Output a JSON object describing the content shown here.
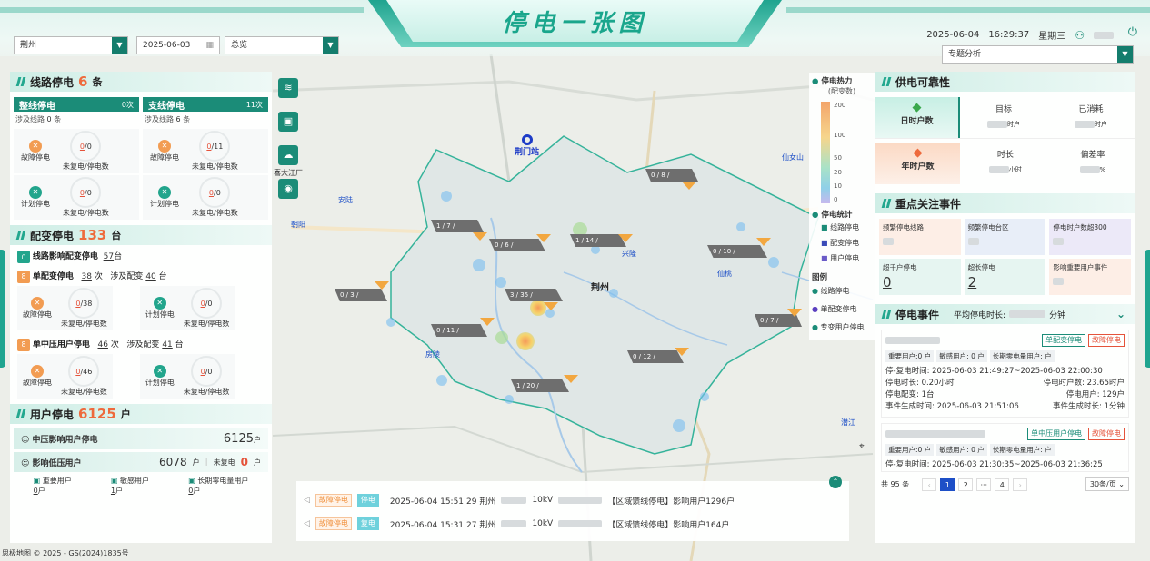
{
  "header": {
    "title": "停电一张图",
    "city": "荆州",
    "date": "2025-06-03",
    "scope": "总览",
    "now_date": "2025-06-04",
    "now_time": "16:29:37",
    "weekday": "星期三",
    "analysis": "专题分析"
  },
  "line": {
    "title": "线路停电",
    "count": "6",
    "unit": "条",
    "whole": {
      "title": "整线停电",
      "count": "0",
      "count_unit": "次",
      "involve_label": "涉及线路",
      "involve": "0",
      "involve_unit": "条",
      "fault_label": "故障停电",
      "fault_a": "0",
      "fault_b": "0",
      "plan_label": "计划停电",
      "plan_a": "0",
      "plan_b": "0"
    },
    "branch": {
      "title": "支线停电",
      "count": "11",
      "count_unit": "次",
      "involve_label": "涉及线路",
      "involve": "6",
      "involve_unit": "条",
      "fault_label": "故障停电",
      "fault_a": "0",
      "fault_b": "11",
      "plan_label": "计划停电",
      "plan_a": "0",
      "plan_b": "0"
    },
    "sub": "未复电/停电数"
  },
  "transformer": {
    "title": "配变停电",
    "count": "133",
    "unit": "台",
    "line_affect_label": "线路影响配变停电",
    "line_affect": "57",
    "line_affect_unit": "台",
    "single": {
      "title": "单配变停电",
      "count": "38",
      "count_unit": "次",
      "involve_label": "涉及配变",
      "involve": "40",
      "involve_unit": "台",
      "fault_label": "故障停电",
      "fault_a": "0",
      "fault_b": "38",
      "plan_label": "计划停电",
      "plan_a": "0",
      "plan_b": "0"
    },
    "mv": {
      "title": "单中压用户停电",
      "count": "46",
      "count_unit": "次",
      "involve_label": "涉及配变",
      "involve": "41",
      "involve_unit": "台",
      "fault_label": "故障停电",
      "fault_a": "0",
      "fault_b": "46",
      "plan_label": "计划停电",
      "plan_a": "0",
      "plan_b": "0"
    }
  },
  "user": {
    "title": "用户停电",
    "count": "6125",
    "unit": "户",
    "mv_label": "中压影响用户停电",
    "mv": "6125",
    "mv_unit": "户",
    "lv_label": "影响低压用户",
    "lv": "6078",
    "lv_unit": "户",
    "unrestored_label": "未复电",
    "unrestored": "0",
    "unrestored_unit": "户",
    "important_label": "重要用户",
    "important": "0",
    "important_unit": "户",
    "sensitive_label": "敏感用户",
    "sensitive": "1",
    "sensitive_unit": "户",
    "longzero_label": "长期零电量用户",
    "longzero": "0",
    "longzero_unit": "户"
  },
  "legend": {
    "heat_title": "停电热力",
    "heat_sub": "(配变数)",
    "ticks": [
      "200",
      "100",
      "50",
      "20",
      "10",
      "0"
    ],
    "stat_title": "停电统计",
    "stats": [
      "线路停电",
      "配变停电",
      "用户停电"
    ],
    "icon_title": "图例",
    "icons": [
      "线路停电",
      "单配变停电",
      "专变用户停电"
    ]
  },
  "map_labels": {
    "station": "荆门站",
    "city": "荆州",
    "city2": "兴隆",
    "city3": "仙桃",
    "city4": "潜江",
    "city5": "仙女山",
    "city6": "安陆",
    "city7": "朝阳",
    "city8": "房陵",
    "river": "喜大江厂",
    "attribution": "思极地图 © 2025 - GS(2024)1835号"
  },
  "map_cards": [
    "0 / 8 /",
    "1 / 7 /",
    "0 / 6 /",
    "1 / 14 /",
    "0 / 10 /",
    "0 / 3 /",
    "3 / 35 /",
    "0 / 7 /",
    "0 / 11 /",
    "0 / 12 /",
    "1 / 20 /"
  ],
  "alerts": [
    {
      "t1": "故障停电",
      "t2": "停电",
      "text": "2025-06-04 15:51:29 荆州",
      "mid": "10kV",
      "tail": "【区域馈线停电】影响用户1296户"
    },
    {
      "t1": "故障停电",
      "t2": "复电",
      "text": "2025-06-04 15:31:27 荆州",
      "mid": "10kV",
      "tail": "【区域馈线停电】影响用户164户"
    }
  ],
  "reliability": {
    "title": "供电可靠性",
    "day_label": "日时户数",
    "year_label": "年时户数",
    "target": "目标",
    "consumed": "已消耗",
    "duration": "时长",
    "deviation": "偏差率",
    "u1": "时户",
    "u2": "时户",
    "u3": "小时",
    "u4": "%"
  },
  "focus": {
    "title": "重点关注事件",
    "items": [
      {
        "label": "频繁停电线路",
        "value": ""
      },
      {
        "label": "频繁停电台区",
        "value": ""
      },
      {
        "label": "停电时户数超300",
        "value": ""
      },
      {
        "label": "超千户停电",
        "value": "0"
      },
      {
        "label": "超长停电",
        "value": "2"
      },
      {
        "label": "影响重要用户事件",
        "value": ""
      }
    ]
  },
  "events": {
    "title": "停电事件",
    "avg_label": "平均停电时长:",
    "avg_unit": "分钟",
    "list": [
      {
        "tags": [
          "单配变停电",
          "故障停电"
        ],
        "l1": "重要用户:0 户",
        "l2": "敏感用户: 0 户",
        "l3": "长期零电量用户: 户",
        "time": "停-复电时间:  2025-06-03 21:49:27~2025-06-03 22:00:30",
        "dur": "停电时长:  0.20小时",
        "hh": "停电时户数:  23.65时户",
        "cnt": "停电配变:  1台",
        "users": "停电用户:  129户",
        "gen": "事件生成时间:  2025-06-03 21:51:06",
        "gen2": "事件生成时长:  1分钟"
      },
      {
        "tags": [
          "单中压用户停电",
          "故障停电"
        ],
        "l1": "重要用户:0 户",
        "l2": "敏感用户: 0 户",
        "l3": "长期零电量用户: 户",
        "time": "停-复电时间:  2025-06-03 21:30:35~2025-06-03 21:36:25"
      }
    ],
    "total": "共 95 条",
    "pages": [
      "1",
      "2",
      "···",
      "4"
    ],
    "page_size": "30条/页"
  }
}
